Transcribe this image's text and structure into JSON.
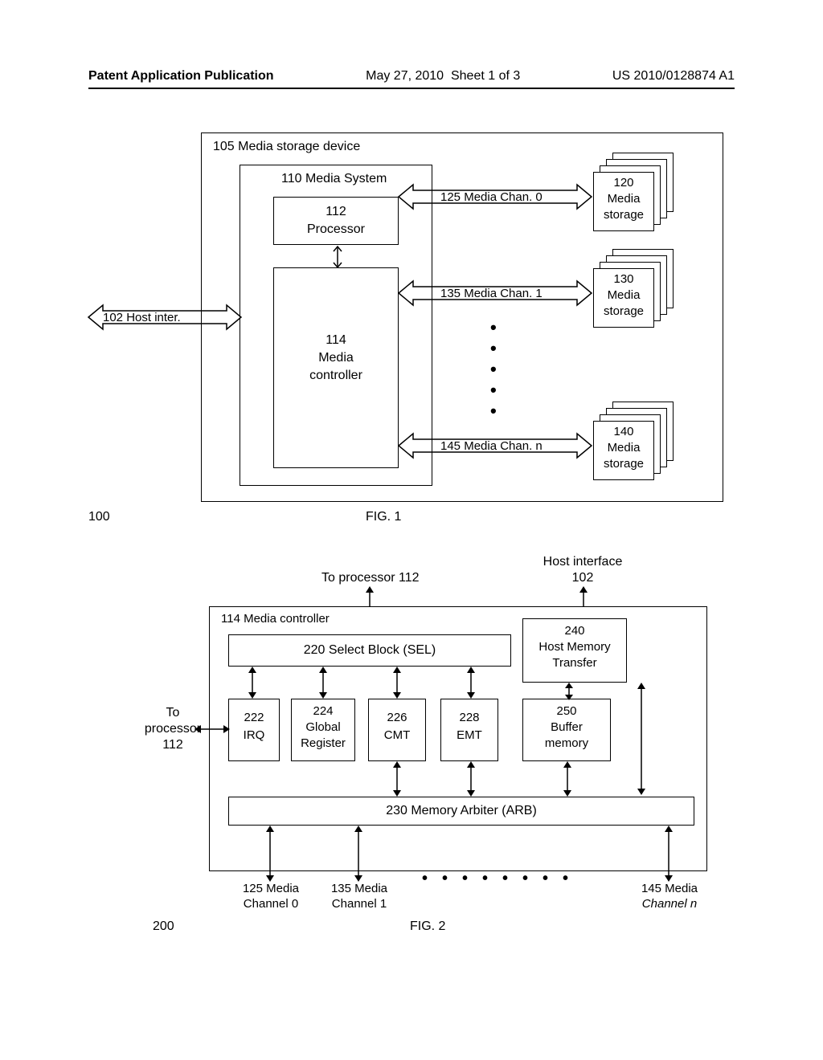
{
  "header": {
    "left": "Patent Application Publication",
    "center_date": "May 27, 2010",
    "center_sheet": "Sheet 1 of 3",
    "right": "US 2010/0128874 A1"
  },
  "fig1": {
    "ref_outer": "100",
    "caption": "FIG. 1",
    "outer_label": "105 Media storage device",
    "media_system": "110 Media System",
    "processor_num": "112",
    "processor_lbl": "Processor",
    "controller_num": "114",
    "controller_lbl1": "Media",
    "controller_lbl2": "controller",
    "host_inter": "102 Host inter.",
    "chan0": "125 Media Chan. 0",
    "chan1": "135 Media Chan. 1",
    "chan_n": "145 Media Chan. n",
    "storage0_num": "120",
    "storage0_l1": "Media",
    "storage0_l2": "storage",
    "storage1_num": "130",
    "storage1_l1": "Media",
    "storage1_l2": "storage",
    "storageN_num": "140",
    "storageN_l1": "Media",
    "storageN_l2": "storage"
  },
  "fig2": {
    "ref_outer": "200",
    "caption": "FIG. 2",
    "to_proc": "To processor 112",
    "host_if_l1": "Host interface",
    "host_if_l2": "102",
    "controller_lbl": "114 Media controller",
    "sel": "220 Select Block  (SEL)",
    "hmt_num": "240",
    "hmt_l1": "Host Memory",
    "hmt_l2": "Transfer",
    "irq_num": "222",
    "irq_lbl": "IRQ",
    "greg_num": "224",
    "greg_l1": "Global",
    "greg_l2": "Register",
    "cmt_num": "226",
    "cmt_lbl": "CMT",
    "emt_num": "228",
    "emt_lbl": "EMT",
    "buf_num": "250",
    "buf_l1": "Buffer",
    "buf_l2": "memory",
    "arb": "230 Memory Arbiter (ARB)",
    "to_proc2_l1": "To",
    "to_proc2_l2": "processor",
    "to_proc2_l3": "112",
    "mc0_l1": "125 Media",
    "mc0_l2": "Channel 0",
    "mc1_l1": "135 Media",
    "mc1_l2": "Channel 1",
    "mcn_l1": "145 Media",
    "mcn_l2": "Channel n"
  }
}
